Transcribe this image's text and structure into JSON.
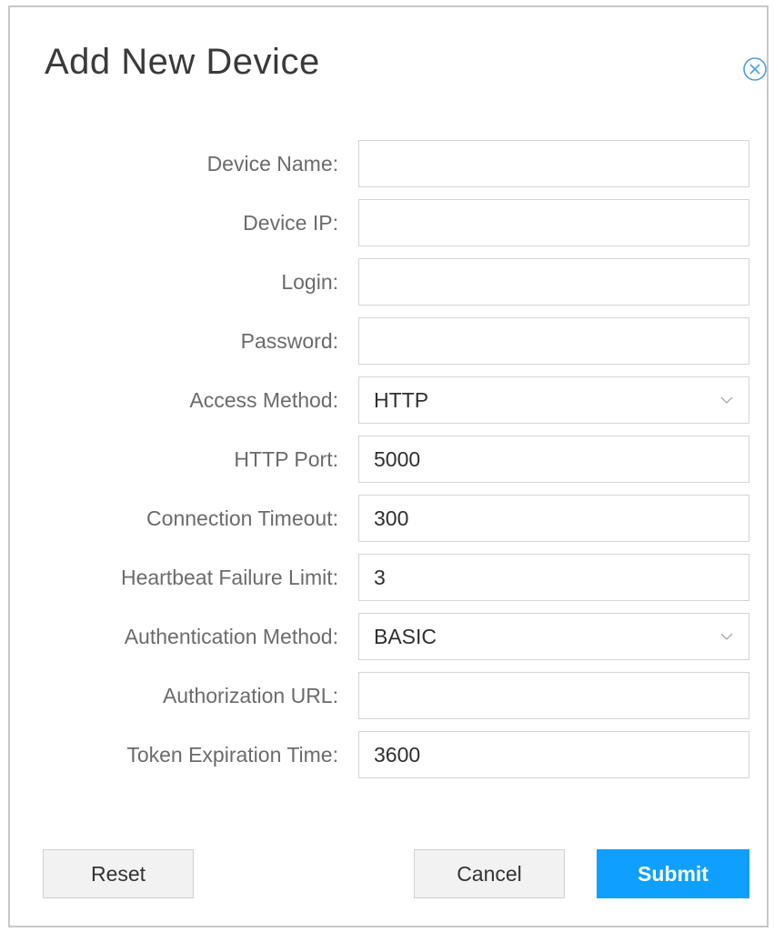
{
  "dialog": {
    "title": "Add New Device",
    "close_icon": "close-circle-icon"
  },
  "form": {
    "fields": [
      {
        "label": "Device Name:",
        "value": "",
        "type": "text"
      },
      {
        "label": "Device IP:",
        "value": "",
        "type": "text"
      },
      {
        "label": "Login:",
        "value": "",
        "type": "text"
      },
      {
        "label": "Password:",
        "value": "",
        "type": "password"
      },
      {
        "label": "Access Method:",
        "value": "HTTP",
        "type": "select"
      },
      {
        "label": "HTTP Port:",
        "value": "5000",
        "type": "text"
      },
      {
        "label": "Connection Timeout:",
        "value": "300",
        "type": "text"
      },
      {
        "label": "Heartbeat Failure Limit:",
        "value": "3",
        "type": "text"
      },
      {
        "label": "Authentication Method:",
        "value": "BASIC",
        "type": "select"
      },
      {
        "label": "Authorization URL:",
        "value": "",
        "type": "text"
      },
      {
        "label": "Token Expiration Time:",
        "value": "3600",
        "type": "text"
      }
    ]
  },
  "buttons": {
    "reset_label": "Reset",
    "cancel_label": "Cancel",
    "submit_label": "Submit"
  },
  "colors": {
    "primary": "#0f9fff",
    "close_icon": "#4a9fe8",
    "border": "#d4d4d4"
  }
}
